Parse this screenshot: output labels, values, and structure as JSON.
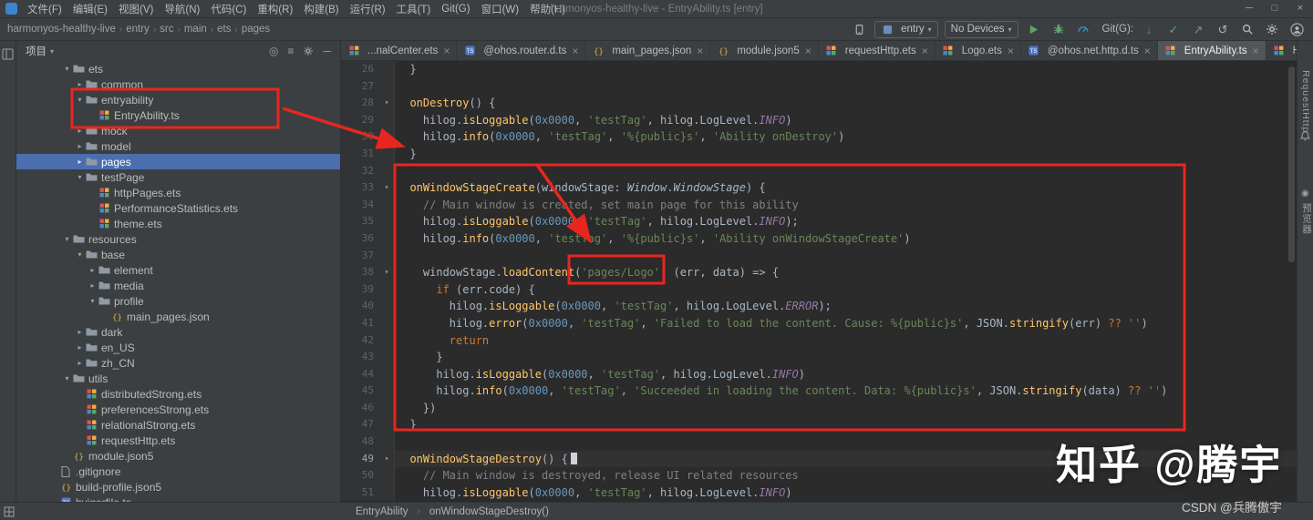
{
  "window": {
    "title": "harmonyos-healthy-live - EntryAbility.ts [entry]",
    "menus": [
      "文件(F)",
      "编辑(E)",
      "视图(V)",
      "导航(N)",
      "代码(C)",
      "重构(R)",
      "构建(B)",
      "运行(R)",
      "工具(T)",
      "Git(G)",
      "窗口(W)",
      "帮助(H)"
    ]
  },
  "toolbar": {
    "breadcrumb": [
      "harmonyos-healthy-live",
      "entry",
      "src",
      "main",
      "ets",
      "pages"
    ],
    "run_config": "entry",
    "device": "No Devices",
    "git_label": "Git(G):"
  },
  "project": {
    "title": "项目",
    "tree": [
      {
        "label": "ets",
        "type": "folder",
        "level": 3,
        "chevron": "open"
      },
      {
        "label": "common",
        "type": "folder",
        "level": 4,
        "chevron": "closed"
      },
      {
        "label": "entryability",
        "type": "folder",
        "level": 4,
        "chevron": "open"
      },
      {
        "label": "EntryAbility.ts",
        "type": "ets",
        "level": 5
      },
      {
        "label": "mock",
        "type": "folder",
        "level": 4,
        "chevron": "closed"
      },
      {
        "label": "model",
        "type": "folder",
        "level": 4,
        "chevron": "closed"
      },
      {
        "label": "pages",
        "type": "folder",
        "level": 4,
        "chevron": "closed",
        "selected": true
      },
      {
        "label": "testPage",
        "type": "folder",
        "level": 4,
        "chevron": "open"
      },
      {
        "label": "httpPages.ets",
        "type": "ets",
        "level": 5
      },
      {
        "label": "PerformanceStatistics.ets",
        "type": "ets",
        "level": 5
      },
      {
        "label": "theme.ets",
        "type": "ets",
        "level": 5
      },
      {
        "label": "resources",
        "type": "folder",
        "level": 3,
        "chevron": "open"
      },
      {
        "label": "base",
        "type": "folder",
        "level": 4,
        "chevron": "open"
      },
      {
        "label": "element",
        "type": "folder",
        "level": 5,
        "chevron": "closed"
      },
      {
        "label": "media",
        "type": "folder",
        "level": 5,
        "chevron": "closed"
      },
      {
        "label": "profile",
        "type": "folder",
        "level": 5,
        "chevron": "open"
      },
      {
        "label": "main_pages.json",
        "type": "json",
        "level": 6
      },
      {
        "label": "dark",
        "type": "folder",
        "level": 4,
        "chevron": "closed"
      },
      {
        "label": "en_US",
        "type": "folder",
        "level": 4,
        "chevron": "closed"
      },
      {
        "label": "zh_CN",
        "type": "folder",
        "level": 4,
        "chevron": "closed"
      },
      {
        "label": "utils",
        "type": "folder",
        "level": 3,
        "chevron": "open"
      },
      {
        "label": "distributedStrong.ets",
        "type": "ets",
        "level": 4
      },
      {
        "label": "preferencesStrong.ets",
        "type": "ets",
        "level": 4
      },
      {
        "label": "relationalStrong.ets",
        "type": "ets",
        "level": 4
      },
      {
        "label": "requestHttp.ets",
        "type": "ets",
        "level": 4
      },
      {
        "label": "module.json5",
        "type": "json",
        "level": 3
      },
      {
        "label": ".gitignore",
        "type": "file",
        "level": 2
      },
      {
        "label": "build-profile.json5",
        "type": "json",
        "level": 2
      },
      {
        "label": "hvigorfile.ts",
        "type": "ts",
        "level": 2
      }
    ]
  },
  "tabs": [
    {
      "label": "...nalCenter.ets",
      "type": "ets"
    },
    {
      "label": "@ohos.router.d.ts",
      "type": "ts"
    },
    {
      "label": "main_pages.json",
      "type": "json"
    },
    {
      "label": "module.json5",
      "type": "json"
    },
    {
      "label": "requestHttp.ets",
      "type": "ets"
    },
    {
      "label": "Logo.ets",
      "type": "ets"
    },
    {
      "label": "@ohos.net.http.d.ts",
      "type": "ts"
    },
    {
      "label": "EntryAbility.ts",
      "type": "ets",
      "active": true
    },
    {
      "label": "Home.ets",
      "type": "ets"
    }
  ],
  "editor": {
    "lines": [
      {
        "n": 26,
        "t": [
          [
            "pl",
            "  }"
          ]
        ]
      },
      {
        "n": 27,
        "t": []
      },
      {
        "n": 28,
        "fold": true,
        "t": [
          [
            "pl",
            "  "
          ],
          [
            "fn",
            "onDestroy"
          ],
          [
            "pl",
            "() {"
          ]
        ]
      },
      {
        "n": 29,
        "t": [
          [
            "pl",
            "    hilog."
          ],
          [
            "fn",
            "isLoggable"
          ],
          [
            "pl",
            "("
          ],
          [
            "num",
            "0x0000"
          ],
          [
            "pl",
            ", "
          ],
          [
            "str",
            "'testTag'"
          ],
          [
            "pl",
            ", hilog.LogLevel."
          ],
          [
            "fld",
            "INFO"
          ],
          [
            "pl",
            ")"
          ]
        ]
      },
      {
        "n": 30,
        "t": [
          [
            "pl",
            "    hilog."
          ],
          [
            "fn",
            "info"
          ],
          [
            "pl",
            "("
          ],
          [
            "num",
            "0x0000"
          ],
          [
            "pl",
            ", "
          ],
          [
            "str",
            "'testTag'"
          ],
          [
            "pl",
            ", "
          ],
          [
            "str",
            "'%{public}s'"
          ],
          [
            "pl",
            ", "
          ],
          [
            "str",
            "'Ability onDestroy'"
          ],
          [
            "pl",
            ")"
          ]
        ]
      },
      {
        "n": 31,
        "t": [
          [
            "pl",
            "  }"
          ]
        ]
      },
      {
        "n": 32,
        "t": []
      },
      {
        "n": 33,
        "fold": true,
        "t": [
          [
            "pl",
            "  "
          ],
          [
            "fn",
            "onWindowStageCreate"
          ],
          [
            "pl",
            "(windowStage: "
          ],
          [
            "cls",
            "Window"
          ],
          [
            "pl",
            "."
          ],
          [
            "cls",
            "WindowStage"
          ],
          [
            "pl",
            ") {"
          ]
        ]
      },
      {
        "n": 34,
        "t": [
          [
            "cm",
            "    // Main window is created, set main page for this ability"
          ]
        ]
      },
      {
        "n": 35,
        "t": [
          [
            "pl",
            "    hilog."
          ],
          [
            "fn",
            "isLoggable"
          ],
          [
            "pl",
            "("
          ],
          [
            "num",
            "0x0000"
          ],
          [
            "pl",
            ", "
          ],
          [
            "str",
            "'testTag'"
          ],
          [
            "pl",
            ", hilog.LogLevel."
          ],
          [
            "fld",
            "INFO"
          ],
          [
            "pl",
            ");"
          ]
        ]
      },
      {
        "n": 36,
        "t": [
          [
            "pl",
            "    hilog."
          ],
          [
            "fn",
            "info"
          ],
          [
            "pl",
            "("
          ],
          [
            "num",
            "0x0000"
          ],
          [
            "pl",
            ", "
          ],
          [
            "str",
            "'testTag'"
          ],
          [
            "pl",
            ", "
          ],
          [
            "str",
            "'%{public}s'"
          ],
          [
            "pl",
            ", "
          ],
          [
            "str",
            "'Ability onWindowStageCreate'"
          ],
          [
            "pl",
            ")"
          ]
        ]
      },
      {
        "n": 37,
        "t": []
      },
      {
        "n": 38,
        "fold": true,
        "t": [
          [
            "pl",
            "    windowStage."
          ],
          [
            "fn",
            "loadContent"
          ],
          [
            "pl",
            "("
          ],
          [
            "str",
            "'pages/Logo'"
          ],
          [
            "pl",
            ", (err, data) => {"
          ]
        ]
      },
      {
        "n": 39,
        "t": [
          [
            "pl",
            "      "
          ],
          [
            "kw",
            "if"
          ],
          [
            "pl",
            " (err.code) {"
          ]
        ]
      },
      {
        "n": 40,
        "t": [
          [
            "pl",
            "        hilog."
          ],
          [
            "fn",
            "isLoggable"
          ],
          [
            "pl",
            "("
          ],
          [
            "num",
            "0x0000"
          ],
          [
            "pl",
            ", "
          ],
          [
            "str",
            "'testTag'"
          ],
          [
            "pl",
            ", hilog.LogLevel."
          ],
          [
            "fld",
            "ERROR"
          ],
          [
            "pl",
            ");"
          ]
        ]
      },
      {
        "n": 41,
        "t": [
          [
            "pl",
            "        hilog."
          ],
          [
            "fn",
            "error"
          ],
          [
            "pl",
            "("
          ],
          [
            "num",
            "0x0000"
          ],
          [
            "pl",
            ", "
          ],
          [
            "str",
            "'testTag'"
          ],
          [
            "pl",
            ", "
          ],
          [
            "str",
            "'Failed to load the content. Cause: %{public}s'"
          ],
          [
            "pl",
            ", JSON."
          ],
          [
            "fn",
            "stringify"
          ],
          [
            "pl",
            "(err) "
          ],
          [
            "kw",
            "??"
          ],
          [
            "pl",
            " "
          ],
          [
            "str",
            "''"
          ],
          [
            "pl",
            ")"
          ]
        ]
      },
      {
        "n": 42,
        "t": [
          [
            "pl",
            "        "
          ],
          [
            "kw",
            "return"
          ]
        ]
      },
      {
        "n": 43,
        "t": [
          [
            "pl",
            "      }"
          ]
        ]
      },
      {
        "n": 44,
        "t": [
          [
            "pl",
            "      hilog."
          ],
          [
            "fn",
            "isLoggable"
          ],
          [
            "pl",
            "("
          ],
          [
            "num",
            "0x0000"
          ],
          [
            "pl",
            ", "
          ],
          [
            "str",
            "'testTag'"
          ],
          [
            "pl",
            ", hilog.LogLevel."
          ],
          [
            "fld",
            "INFO"
          ],
          [
            "pl",
            ")"
          ]
        ]
      },
      {
        "n": 45,
        "t": [
          [
            "pl",
            "      hilog."
          ],
          [
            "fn",
            "info"
          ],
          [
            "pl",
            "("
          ],
          [
            "num",
            "0x0000"
          ],
          [
            "pl",
            ", "
          ],
          [
            "str",
            "'testTag'"
          ],
          [
            "pl",
            ", "
          ],
          [
            "str",
            "'Succeeded in loading the content. Data: %{public}s'"
          ],
          [
            "pl",
            ", JSON."
          ],
          [
            "fn",
            "stringify"
          ],
          [
            "pl",
            "(data) "
          ],
          [
            "kw",
            "??"
          ],
          [
            "pl",
            " "
          ],
          [
            "str",
            "''"
          ],
          [
            "pl",
            ")"
          ]
        ]
      },
      {
        "n": 46,
        "t": [
          [
            "pl",
            "    })"
          ]
        ]
      },
      {
        "n": 47,
        "t": [
          [
            "pl",
            "  }"
          ]
        ]
      },
      {
        "n": 48,
        "t": []
      },
      {
        "n": 49,
        "fold": true,
        "current": true,
        "caret": true,
        "t": [
          [
            "pl",
            "  "
          ],
          [
            "fn",
            "onWindowStageDestroy"
          ],
          [
            "pl",
            "() {"
          ]
        ]
      },
      {
        "n": 50,
        "t": [
          [
            "cm",
            "    // Main window is destroyed, release UI related resources"
          ]
        ]
      },
      {
        "n": 51,
        "t": [
          [
            "pl",
            "    hilog."
          ],
          [
            "fn",
            "isLoggable"
          ],
          [
            "pl",
            "("
          ],
          [
            "num",
            "0x0000"
          ],
          [
            "pl",
            ", "
          ],
          [
            "str",
            "'testTag'"
          ],
          [
            "pl",
            ", hilog.LogLevel."
          ],
          [
            "fld",
            "INFO"
          ],
          [
            "pl",
            ")"
          ]
        ]
      }
    ]
  },
  "status": {
    "breadcrumb": [
      "EntryAbility",
      "onWindowStageDestroy()"
    ]
  },
  "right_strip": {
    "top_label": "RequestHttp",
    "bottom_label": "预览器"
  },
  "watermarks": {
    "large": "知乎 @腾宇",
    "small": "CSDN @兵腾傲宇"
  },
  "colors": {
    "annotation_red": "#e8261f",
    "selection_blue": "#4b6eaf",
    "editor_bg": "#2b2b2b",
    "chrome_bg": "#3c3f41",
    "run_green": "#59a869"
  }
}
